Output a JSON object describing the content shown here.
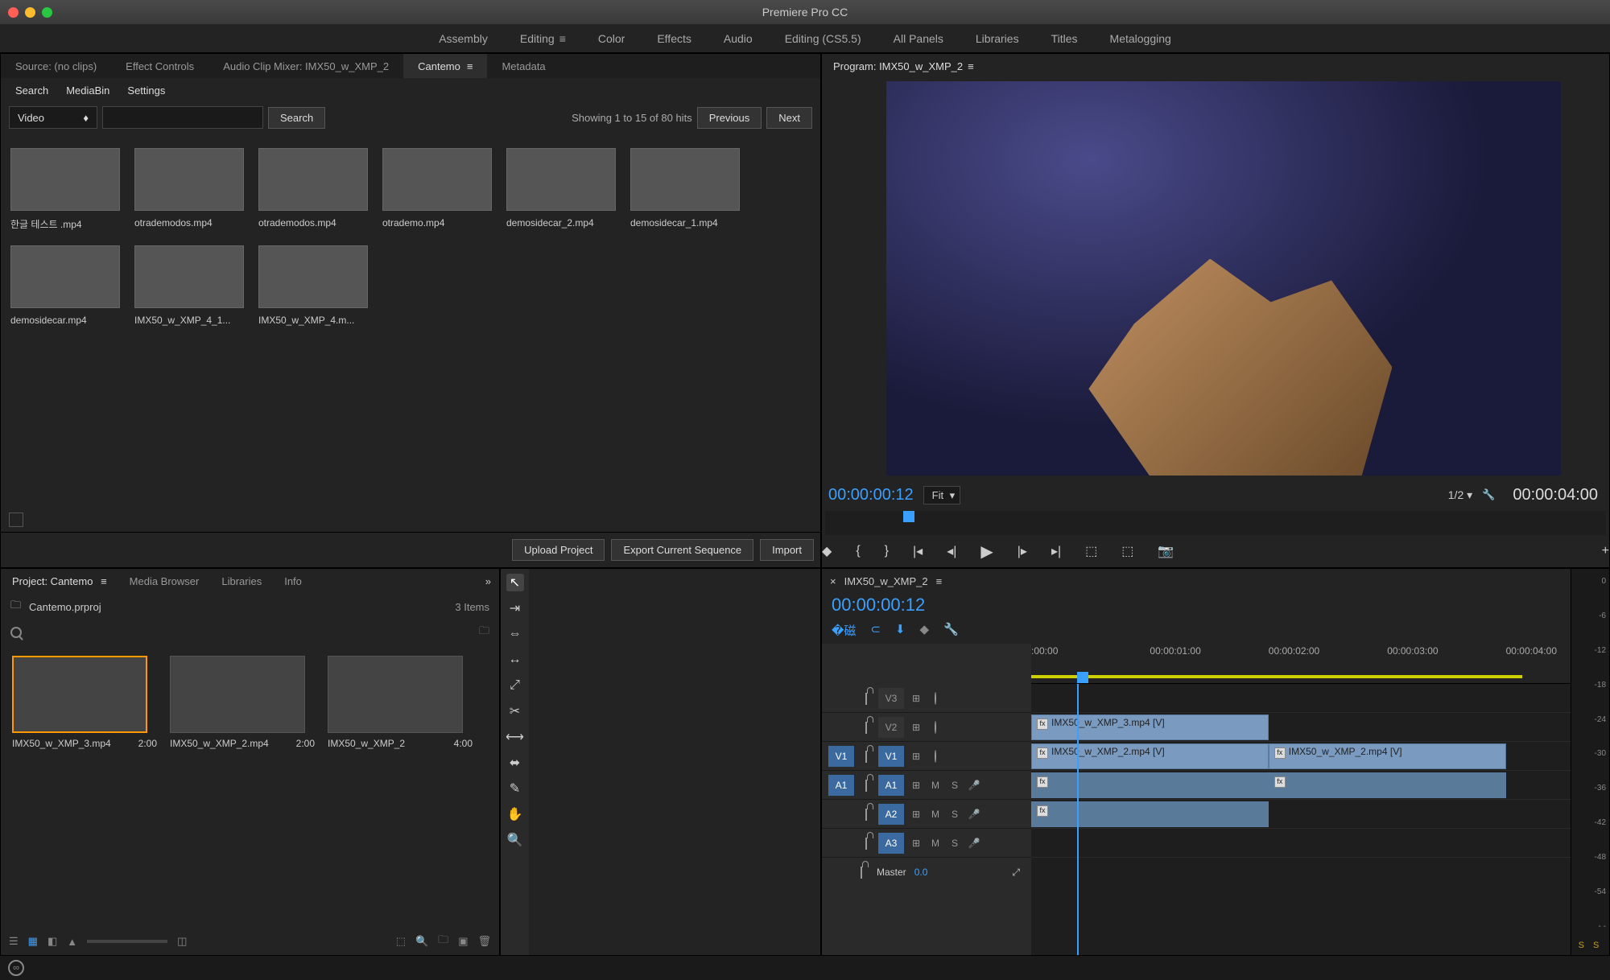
{
  "app_title": "Premiere Pro CC",
  "workspaces": [
    "Assembly",
    "Editing",
    "Color",
    "Effects",
    "Audio",
    "Editing (CS5.5)",
    "All Panels",
    "Libraries",
    "Titles",
    "Metalogging"
  ],
  "workspace_active": "Editing",
  "source_tabs": [
    "Source: (no clips)",
    "Effect Controls",
    "Audio Clip Mixer: IMX50_w_XMP_2",
    "Cantemo",
    "Metadata"
  ],
  "source_active": "Cantemo",
  "subtabs": [
    "Search",
    "MediaBin",
    "Settings"
  ],
  "video_select": "Video",
  "search_btn": "Search",
  "hits_text": "Showing 1 to 15 of 80 hits",
  "prev": "Previous",
  "next": "Next",
  "thumbs": [
    {
      "label": "한글 테스트 .mp4",
      "g": "g1"
    },
    {
      "label": "otrademodos.mp4",
      "g": "g2"
    },
    {
      "label": "otrademodos.mp4",
      "g": "g3"
    },
    {
      "label": "otrademo.mp4",
      "g": "g4"
    },
    {
      "label": "demosidecar_2.mp4",
      "g": "g5"
    },
    {
      "label": "demosidecar_1.mp4",
      "g": "g6"
    },
    {
      "label": "demosidecar.mp4",
      "g": "g7"
    },
    {
      "label": "IMX50_w_XMP_4_1...",
      "g": "g8"
    },
    {
      "label": "IMX50_w_XMP_4.m...",
      "g": "g9"
    }
  ],
  "upload": "Upload Project",
  "export": "Export Current Sequence",
  "import": "Import",
  "program_label": "Program: IMX50_w_XMP_2",
  "tc_left": "00:00:00:12",
  "fit": "Fit",
  "half": "1/2",
  "tc_right": "00:00:04:00",
  "project_tabs": [
    "Project: Cantemo",
    "Media Browser",
    "Libraries",
    "Info"
  ],
  "project_file": "Cantemo.prproj",
  "item_count": "3 Items",
  "proj_thumbs": [
    {
      "label": "IMX50_w_XMP_3.mp4",
      "dur": "2:00",
      "g": "g9",
      "sel": true
    },
    {
      "label": "IMX50_w_XMP_2.mp4",
      "dur": "2:00",
      "g": "g4",
      "sel": false
    },
    {
      "label": "IMX50_w_XMP_2",
      "dur": "4:00",
      "g": "g5",
      "sel": false
    }
  ],
  "seq_name": "IMX50_w_XMP_2",
  "tl_tc": "00:00:00:12",
  "ruler_ticks": [
    ":00:00",
    "00:00:01:00",
    "00:00:02:00",
    "00:00:03:00",
    "00:00:04:00"
  ],
  "tracks": {
    "v3": "V3",
    "v2": "V2",
    "v1": "V1",
    "a1": "A1",
    "a2": "A2",
    "a3": "A3",
    "master": "Master",
    "master_val": "0.0"
  },
  "clips": {
    "v2": "IMX50_w_XMP_3.mp4 [V]",
    "v1a": "IMX50_w_XMP_2.mp4 [V]",
    "v1b": "IMX50_w_XMP_2.mp4 [V]"
  },
  "meter_scale": [
    "0",
    "-6",
    "-12",
    "-18",
    "-24",
    "-30",
    "-36",
    "-42",
    "-48",
    "-54",
    "- -"
  ],
  "meter_ss": "S  S",
  "m": "M",
  "s": "S"
}
